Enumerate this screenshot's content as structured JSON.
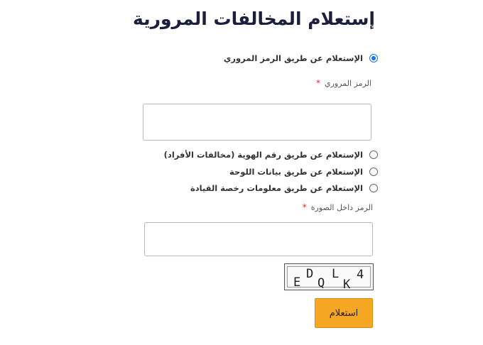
{
  "page_title": "إستعلام المخالفات المرورية",
  "options": {
    "by_traffic_code": "الإستعلام عن طريق الرمز المروري",
    "by_id": "الإستعلام عن طريق رقم الهوية (مخالفات الأفراد)",
    "by_plate": "الإستعلام عن طريق بيانات اللوحة",
    "by_license": "الإستعلام عن طريق معلومات رخصة القيادة"
  },
  "selected_option": "by_traffic_code",
  "traffic_code_field": {
    "label": "الرمز المروري",
    "required_mark": "*",
    "value": ""
  },
  "captcha_field": {
    "label": "الرمز داخل الصورة",
    "required_mark": "*",
    "value": ""
  },
  "captcha_image": {
    "chars": [
      "E",
      "D",
      "Q",
      "L",
      "K",
      "4"
    ]
  },
  "submit_label": "استعلام"
}
